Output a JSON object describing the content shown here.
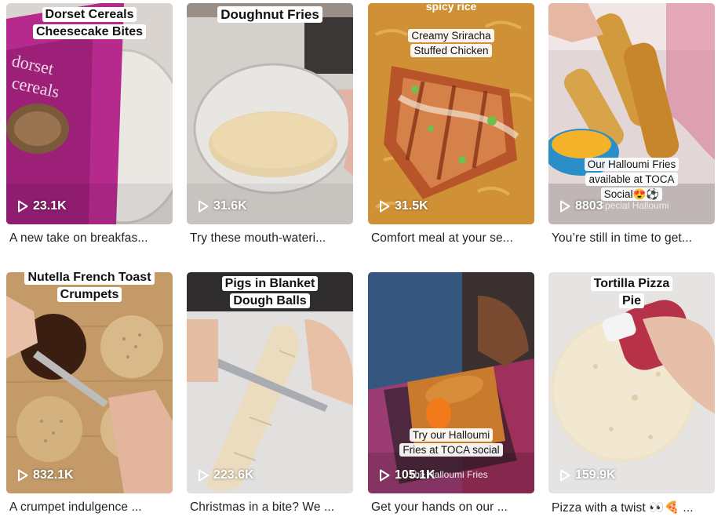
{
  "videos": [
    {
      "overlay": [
        "Dorset Cereals",
        "Cheesecake Bites"
      ],
      "views": "23.1K",
      "caption": "A new take on breakfas..."
    },
    {
      "overlay": [
        "Doughnut Fries"
      ],
      "views": "31.6K",
      "caption": "Try these mouth-wateri..."
    },
    {
      "top_text": "spicy rice",
      "overlay": [
        "Creamy Sriracha",
        "Stuffed Chicken"
      ],
      "views": "31.5K",
      "caption": "Comfort meal at your se..."
    },
    {
      "overlay": [
        "Our Halloumi Fries",
        "available at TOCA",
        "Social😍⚽"
      ],
      "sub_text": "Special Halloumi",
      "views": "8803",
      "caption": "You’re still in time to get..."
    },
    {
      "overlay": [
        "Nutella French Toast",
        "Crumpets"
      ],
      "views": "832.1K",
      "caption": "A crumpet indulgence ..."
    },
    {
      "overlay": [
        "Pigs in Blanket",
        "Dough Balls"
      ],
      "views": "223.6K",
      "caption": "Christmas in a bite? We ..."
    },
    {
      "overlay": [
        "Try our Halloumi",
        "Fries at TOCA social"
      ],
      "sub_text": "The Halloumi Fries",
      "views": "105.1K",
      "caption": "Get your hands on our ..."
    },
    {
      "overlay": [
        "Tortilla Pizza",
        "Pie"
      ],
      "views": "159.9K",
      "caption": "Pizza with a twist 👀🍕 ..."
    }
  ],
  "icons": {
    "views": "play-icon"
  }
}
